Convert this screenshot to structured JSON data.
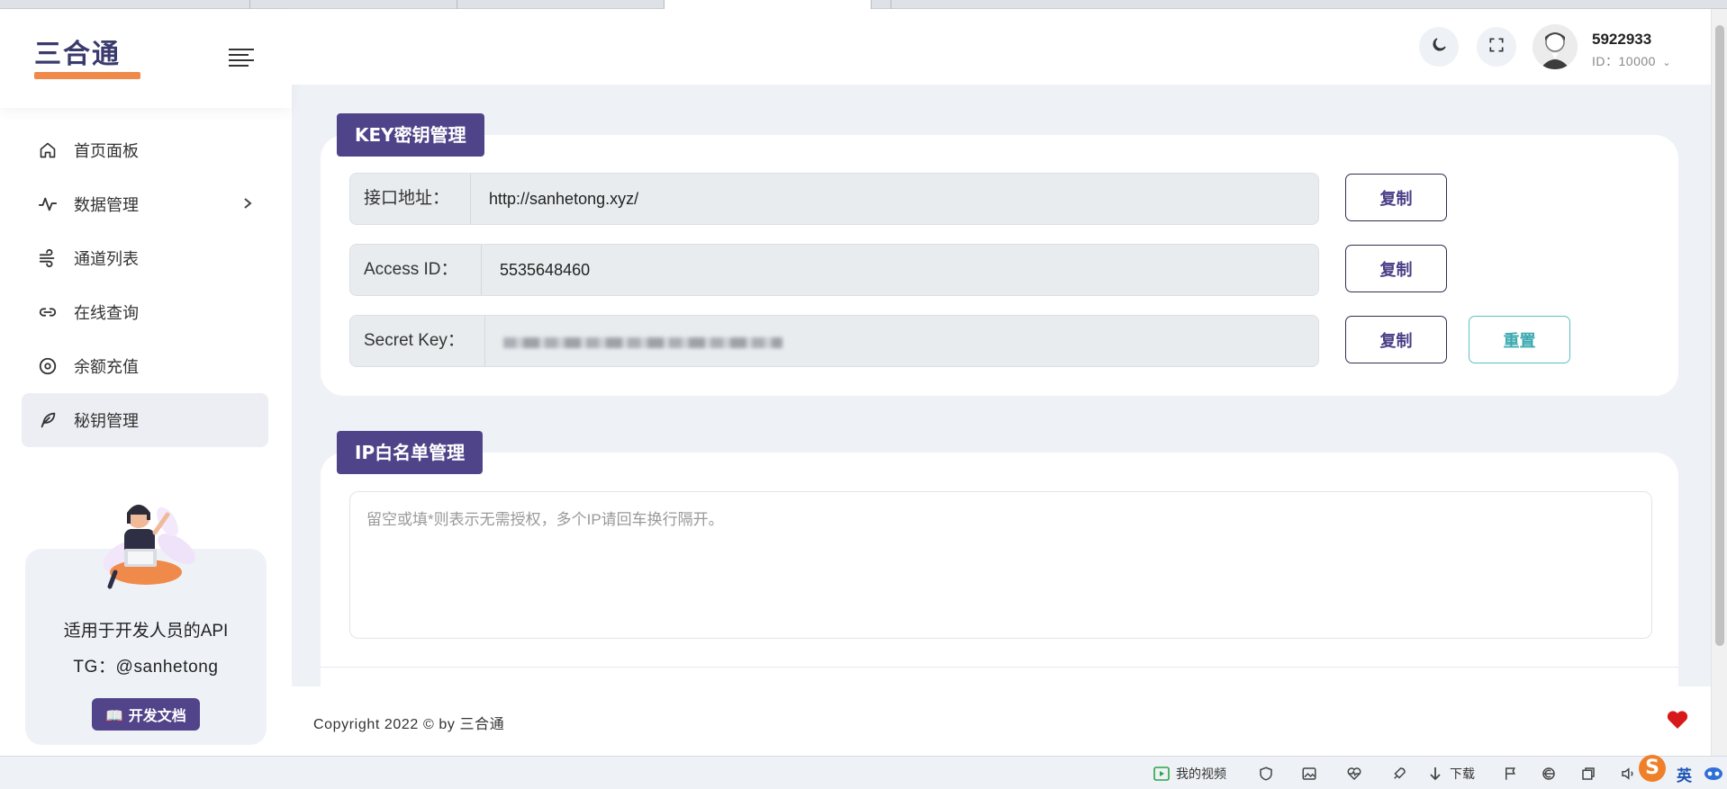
{
  "app": {
    "logo_text": "三合通"
  },
  "sidebar": {
    "items": [
      {
        "label": "首页面板",
        "icon": "home-icon"
      },
      {
        "label": "数据管理",
        "icon": "activity-icon"
      },
      {
        "label": "通道列表",
        "icon": "wind-icon"
      },
      {
        "label": "在线查询",
        "icon": "link-icon"
      },
      {
        "label": "余额充值",
        "icon": "target-icon"
      },
      {
        "label": "秘钥管理",
        "icon": "feather-icon"
      }
    ],
    "promo": {
      "line1": "适用于开发人员的API",
      "line2": "TG：@sanhetong",
      "button_label": "开发文档"
    }
  },
  "header": {
    "user_name": "5922933",
    "user_id": "ID：10000"
  },
  "key_card": {
    "title": "KEY密钥管理",
    "fields": [
      {
        "label": "接口地址：",
        "value": "http://sanhetong.xyz/"
      },
      {
        "label": "Access ID：",
        "value": "5535648460"
      },
      {
        "label": "Secret Key：",
        "value": ""
      }
    ],
    "copy_label": "复制",
    "reset_label": "重置"
  },
  "ip_card": {
    "title": "IP白名单管理",
    "placeholder": "留空或填*则表示无需授权，多个IP请回车换行隔开。"
  },
  "footer": {
    "copyright": "Copyright 2022 © by 三合通"
  },
  "taskbar": {
    "my_video": "我的视频",
    "download": "下载",
    "ime_lang": "英"
  },
  "colors": {
    "primary": "#4f4489",
    "accent_orange": "#f08a4b",
    "teal": "#3aa9b0",
    "heart": "#d7191b"
  }
}
